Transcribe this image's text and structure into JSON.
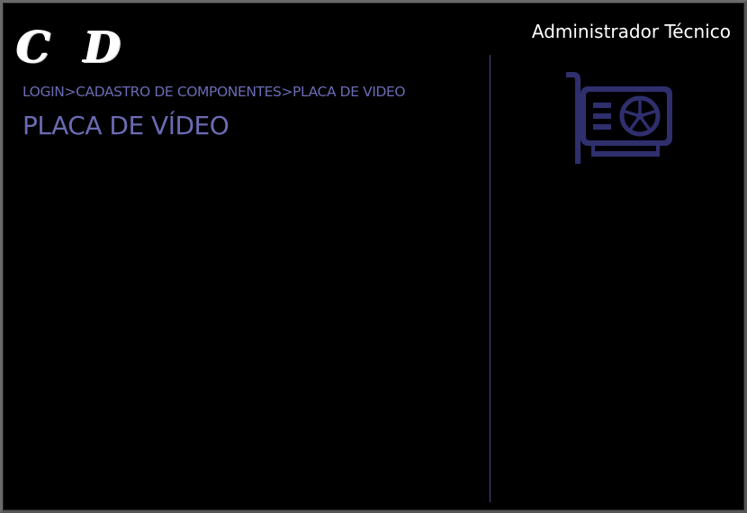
{
  "header": {
    "logo_text": "C D",
    "user_role": "Administrador Técnico"
  },
  "breadcrumb": {
    "items": [
      "LOGIN",
      "CADASTRO DE COMPONENTES",
      "PLACA DE VIDEO"
    ],
    "separator": ">"
  },
  "page": {
    "title": "PLACA DE VÍDEO",
    "icon": "graphics-card-icon"
  },
  "colors": {
    "background": "#000000",
    "accent": "#6b6bb4",
    "icon": "#2f2f6e",
    "divider": "#4b4b7f",
    "text": "#ffffff"
  }
}
